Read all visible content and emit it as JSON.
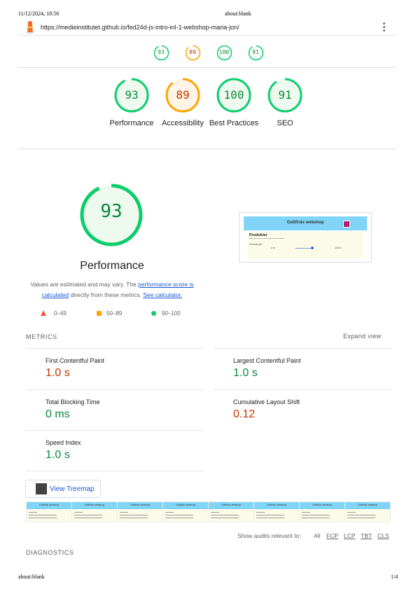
{
  "print": {
    "datetime": "11/12/2024, 18:56",
    "title": "about:blank",
    "footer_left": "about:blank",
    "footer_right": "1/4"
  },
  "topbar": {
    "url": "https://medieinstitutet.github.io/fed24d-js-intro-inl-1-webshop-maria-jon/"
  },
  "mini_scores": [
    {
      "value": "93",
      "score": 93,
      "color": "#0cce6b"
    },
    {
      "value": "89",
      "score": 89,
      "color": "#ffa400"
    },
    {
      "value": "100",
      "score": 100,
      "color": "#0cce6b"
    },
    {
      "value": "91",
      "score": 91,
      "color": "#0cce6b"
    }
  ],
  "gauges": [
    {
      "value": "93",
      "score": 93,
      "label": "Performance",
      "color": "#0cce6b",
      "text": "#0b8a3a",
      "bg": "#eef9f0"
    },
    {
      "value": "89",
      "score": 89,
      "label": "Accessibility",
      "color": "#ffa400",
      "text": "#c33300",
      "bg": "#fff5e6"
    },
    {
      "value": "100",
      "score": 100,
      "label": "Best Practices",
      "color": "#0cce6b",
      "text": "#0b8a3a",
      "bg": "#eef9f0"
    },
    {
      "value": "91",
      "score": 91,
      "label": "SEO",
      "color": "#0cce6b",
      "text": "#0b8a3a",
      "bg": "#eef9f0"
    }
  ],
  "performance": {
    "score": "93",
    "score_num": 93,
    "title": "Performance",
    "desc_prefix": "Values are estimated and may vary. The ",
    "desc_link1": "performance score is calculated",
    "desc_middle": " directly from these metrics. ",
    "desc_link2": "See calculator."
  },
  "legend": [
    {
      "range": "0–49",
      "shape": "triangle",
      "color": "#ff4e42"
    },
    {
      "range": "50–89",
      "shape": "square",
      "color": "#ffa400"
    },
    {
      "range": "90–100",
      "shape": "circle",
      "color": "#0cce6b"
    }
  ],
  "screenshot": {
    "title": "Gottfrids webshop",
    "heading": "Produkter",
    "filter": "Prisintervall",
    "from": "0 kr",
    "to": "100 kr"
  },
  "metrics": {
    "header": "METRICS",
    "expand": "Expand view",
    "items": [
      {
        "label": "First Contentful Paint",
        "value": "1.0 s",
        "color": "#c33300"
      },
      {
        "label": "Largest Contentful Paint",
        "value": "1.0 s",
        "color": "#0b8a3a"
      },
      {
        "label": "Total Blocking Time",
        "value": "0 ms",
        "color": "#0b8a3a"
      },
      {
        "label": "Cumulative Layout Shift",
        "value": "0.12",
        "color": "#c33300"
      },
      {
        "label": "Speed Index",
        "value": "1.0 s",
        "color": "#0b8a3a"
      }
    ]
  },
  "treemap": {
    "label": "View Treemap"
  },
  "filmstrip": {
    "frame_title": "Gottfrids webshop"
  },
  "audits": {
    "prefix": "Show audits relevant to:",
    "filters": [
      "All",
      "FCP",
      "LCP",
      "TBT",
      "CLS"
    ]
  },
  "diagnostics": {
    "header": "DIAGNOSTICS"
  }
}
